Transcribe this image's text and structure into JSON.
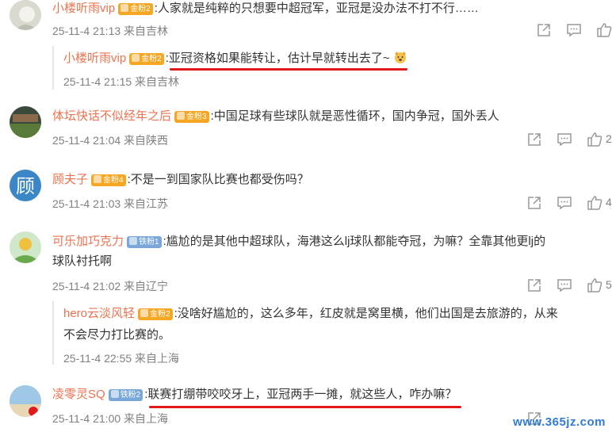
{
  "comments": [
    {
      "name": "小楼听雨vip",
      "badge": "金粉2",
      "text": ":人家就是纯粹的只想要中超冠军，亚冠是没办法不打不行……",
      "time": "25-11-4 21:13",
      "location": "来自吉林",
      "likes": ""
    },
    {
      "name": "体坛快话不似经年之后",
      "badge": "金粉3",
      "text": ":中国足球有些球队就是恶性循环，国内争冠，国外丢人",
      "time": "25-11-4 21:04",
      "location": "来自陕西",
      "likes": "2"
    },
    {
      "name": "顾夫子",
      "badge": "金粉4",
      "text": ":不是一到国家队比赛也都受伤吗？",
      "time": "25-11-4 21:03",
      "location": "来自江苏",
      "likes": "4"
    },
    {
      "name": "可乐加巧克力",
      "badge": "铁粉1",
      "text": ":尴尬的是其他中超球队，海港这么lj球队都能夺冠，为嘛？全靠其他更lj的",
      "text2": "球队衬托啊",
      "time": "25-11-4 21:02",
      "location": "来自辽宁",
      "likes": "5"
    },
    {
      "name": "凌零灵SQ",
      "badge": "铁粉2",
      "text": ":联赛打绷带咬咬牙上，亚冠两手一摊，就这些人，咋办嘛？",
      "time": "25-11-4 21:00",
      "location": "来自上海",
      "likes": ""
    }
  ],
  "replies": [
    {
      "name": "小楼听雨vip",
      "badge": "金粉2",
      "text": ":亚冠资格如果能转让，估计早就转出去了~",
      "time": "25-11-4 21:15",
      "location": "来自吉林"
    },
    {
      "name": "hero云淡风轻",
      "badge": "金粉2",
      "text": ":没啥好尴尬的，这么多年，红皮就是窝里横，他们出国是去旅游的，从来",
      "text2": "不会尽力打比赛的。",
      "time": "25-11-4 22:55",
      "location": "来自上海"
    }
  ],
  "watermark": "www.365jz.com",
  "colors": {
    "name": "#eb7350",
    "gold_badge": "#f5a623",
    "iron_badge": "#79a7d9",
    "meta": "#808080",
    "underline": "#e0191b"
  }
}
